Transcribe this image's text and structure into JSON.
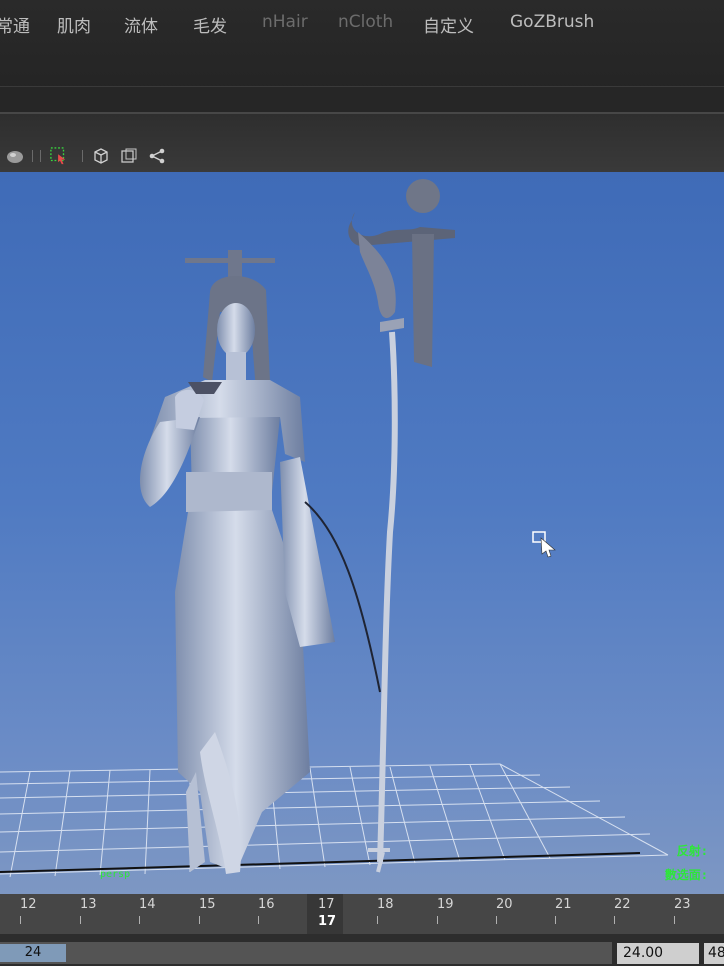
{
  "menu": {
    "items": [
      "常通",
      "肌肉",
      "流体",
      "毛发",
      "nHair",
      "nCloth",
      "自定义",
      "GoZBrush"
    ]
  },
  "viewport": {
    "camera": "persp",
    "hud_reflection": "反射:",
    "hud_selected": "數选面:"
  },
  "timeline": {
    "ticks": [
      "12",
      "13",
      "14",
      "15",
      "16",
      "17",
      "18",
      "19",
      "20",
      "21",
      "22",
      "23"
    ],
    "current_frame": "17"
  },
  "range": {
    "range_end": "24",
    "playback_end": "24.00",
    "anim_end": "48"
  },
  "colors": {
    "viewport_top": "#3f6bb7",
    "viewport_bottom": "#7d97c3",
    "hud_green": "#2ee63a"
  },
  "icons": [
    "render-sphere-icon",
    "select-tool-icon",
    "wireframe-cube-icon",
    "isolate-icon",
    "graph-icon",
    "cursor-icon"
  ]
}
